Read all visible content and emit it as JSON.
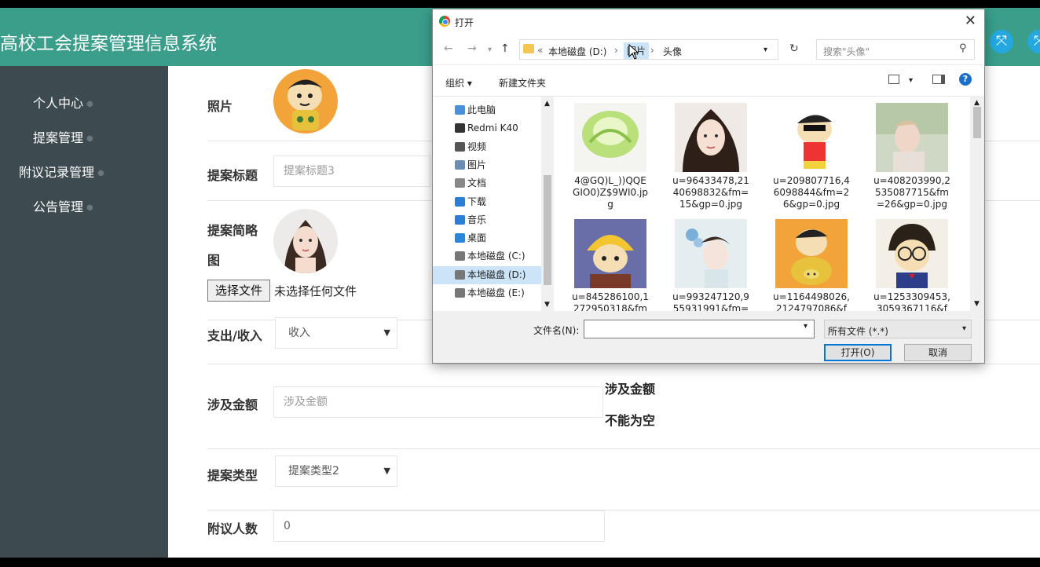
{
  "app": {
    "title": "高校工会提案管理信息系统"
  },
  "sidebar": {
    "items": [
      {
        "label": "个人中心"
      },
      {
        "label": "提案管理"
      },
      {
        "label": "附议记录管理"
      },
      {
        "label": "公告管理"
      }
    ]
  },
  "form": {
    "photo_label": "照片",
    "title_label": "提案标题",
    "title_value": "提案标题3",
    "summary_label_line1": "提案简略",
    "summary_label_line2": "图",
    "choose_file_button": "选择文件",
    "no_file_text": "未选择任何文件",
    "expense_label": "支出/收入",
    "expense_value": "收入",
    "amount_label": "涉及金额",
    "amount_placeholder": "涉及金额",
    "amount_error_line1": "涉及金额",
    "amount_error_line2": "不能为空",
    "type_label": "提案类型",
    "type_value": "提案类型2",
    "seconds_label": "附议人数",
    "seconds_value": "0"
  },
  "dialog": {
    "title": "打开",
    "path": [
      "本地磁盘 (D:)",
      "图片",
      "头像"
    ],
    "path_prefix": "«",
    "search_placeholder": "搜索\"头像\"",
    "organize_label": "组织 ▾",
    "new_folder_label": "新建文件夹",
    "tree": [
      {
        "label": "此电脑",
        "icon": "computer-icon",
        "color": "#4a90d9"
      },
      {
        "label": "Redmi K40",
        "icon": "phone-icon",
        "color": "#333333"
      },
      {
        "label": "视频",
        "icon": "video-icon",
        "color": "#555555"
      },
      {
        "label": "图片",
        "icon": "pictures-icon",
        "color": "#6b8fb3"
      },
      {
        "label": "文档",
        "icon": "documents-icon",
        "color": "#888888"
      },
      {
        "label": "下载",
        "icon": "download-icon",
        "color": "#2a7fd4"
      },
      {
        "label": "音乐",
        "icon": "music-icon",
        "color": "#2a7fd4"
      },
      {
        "label": "桌面",
        "icon": "desktop-icon",
        "color": "#2a86d8"
      },
      {
        "label": "本地磁盘 (C:)",
        "icon": "drive-icon",
        "color": "#777777"
      },
      {
        "label": "本地磁盘 (D:)",
        "icon": "drive-icon",
        "color": "#777777",
        "selected": true
      },
      {
        "label": "本地磁盘 (E:)",
        "icon": "drive-icon",
        "color": "#777777"
      }
    ],
    "files": [
      {
        "name": "4@GQ)L_))QQE\nGIO0)Z$9WI0.jp\ng",
        "thumb": "green-cabbage"
      },
      {
        "name": "u=96433478,21\n40698832&fm=\n15&gp=0.jpg",
        "thumb": "woman-portrait"
      },
      {
        "name": "u=209807716,4\n6098844&fm=2\n6&gp=0.jpg",
        "thumb": "cartoon-boy"
      },
      {
        "name": "u=408203990,2\n535087715&fm\n=26&gp=0.jpg",
        "thumb": "person-photo"
      },
      {
        "name": "u=845286100,1\n272950318&fm",
        "thumb": "cartoon-hat"
      },
      {
        "name": "u=993247120,9\n55931991&fm=",
        "thumb": "woman-flowers"
      },
      {
        "name": "u=1164498026,\n2124797086&f",
        "thumb": "cartoon-pig"
      },
      {
        "name": "u=1253309453,\n3059367116&f",
        "thumb": "cartoon-detective"
      }
    ],
    "filename_label": "文件名(N):",
    "filename_value": "",
    "filter_value": "所有文件 (*.*)",
    "open_button": "打开(O)",
    "cancel_button": "取消"
  },
  "colors": {
    "header": "#3a9e8b",
    "sidebar": "#3d4a4f",
    "accent_blue": "#0078d7"
  }
}
